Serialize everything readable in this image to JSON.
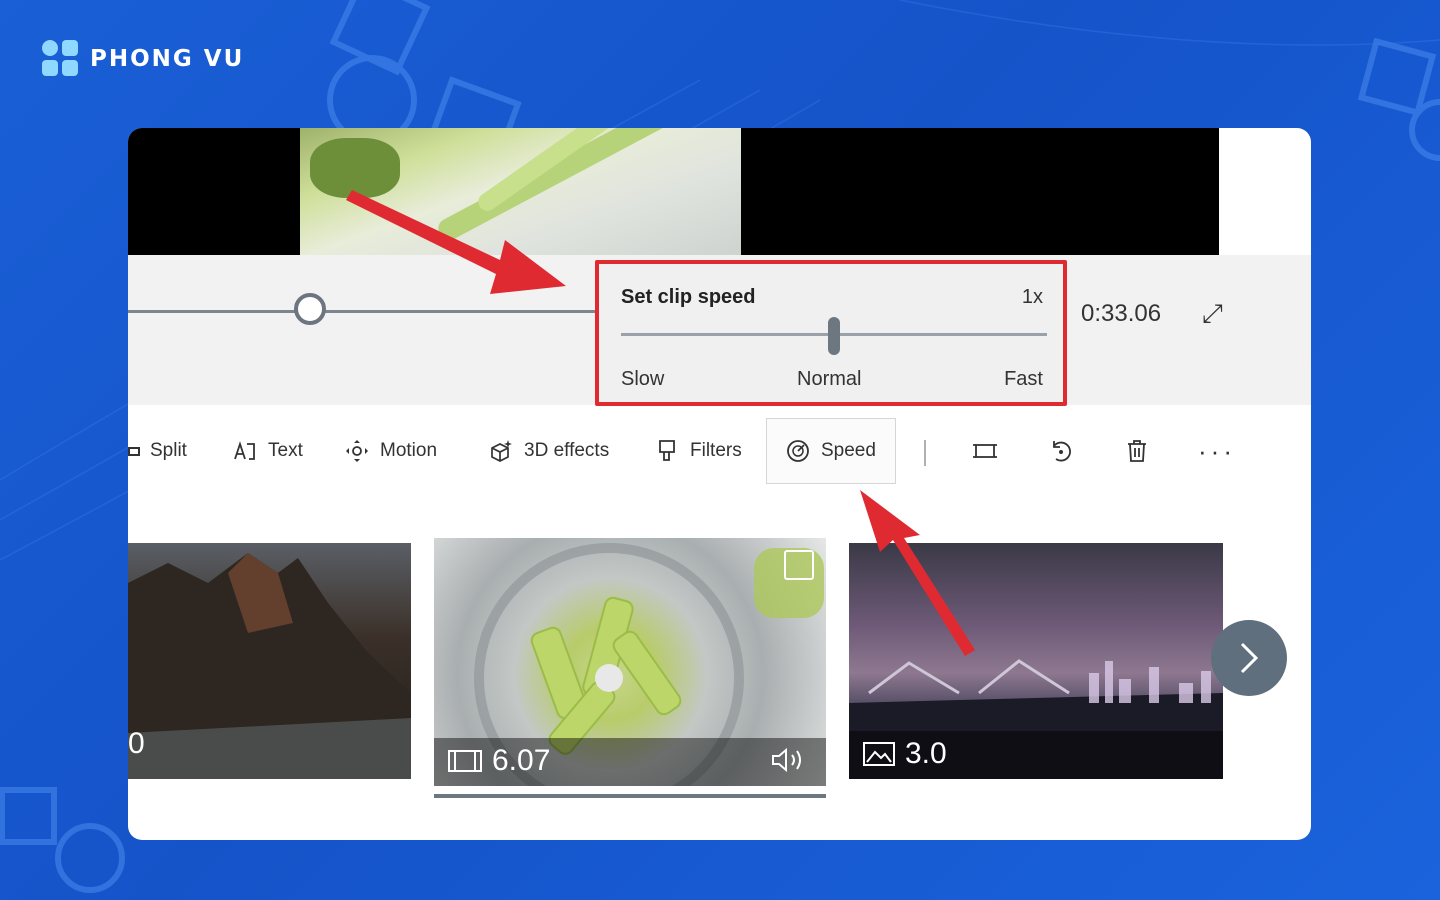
{
  "brand": {
    "name": "PHONG VU"
  },
  "player": {
    "time": "0:33.06"
  },
  "speed_popup": {
    "title": "Set clip speed",
    "value": "1x",
    "slow_label": "Slow",
    "normal_label": "Normal",
    "fast_label": "Fast",
    "position_fraction": 0.5
  },
  "toolbar": {
    "split": "Split",
    "text": "Text",
    "motion": "Motion",
    "effects3d": "3D effects",
    "filters": "Filters",
    "speed": "Speed"
  },
  "clips": [
    {
      "duration": "0"
    },
    {
      "duration": "6.07"
    },
    {
      "duration": "3.0"
    }
  ],
  "colors": {
    "accent_red": "#e02a32",
    "background_blue": "#1a5fd6"
  }
}
